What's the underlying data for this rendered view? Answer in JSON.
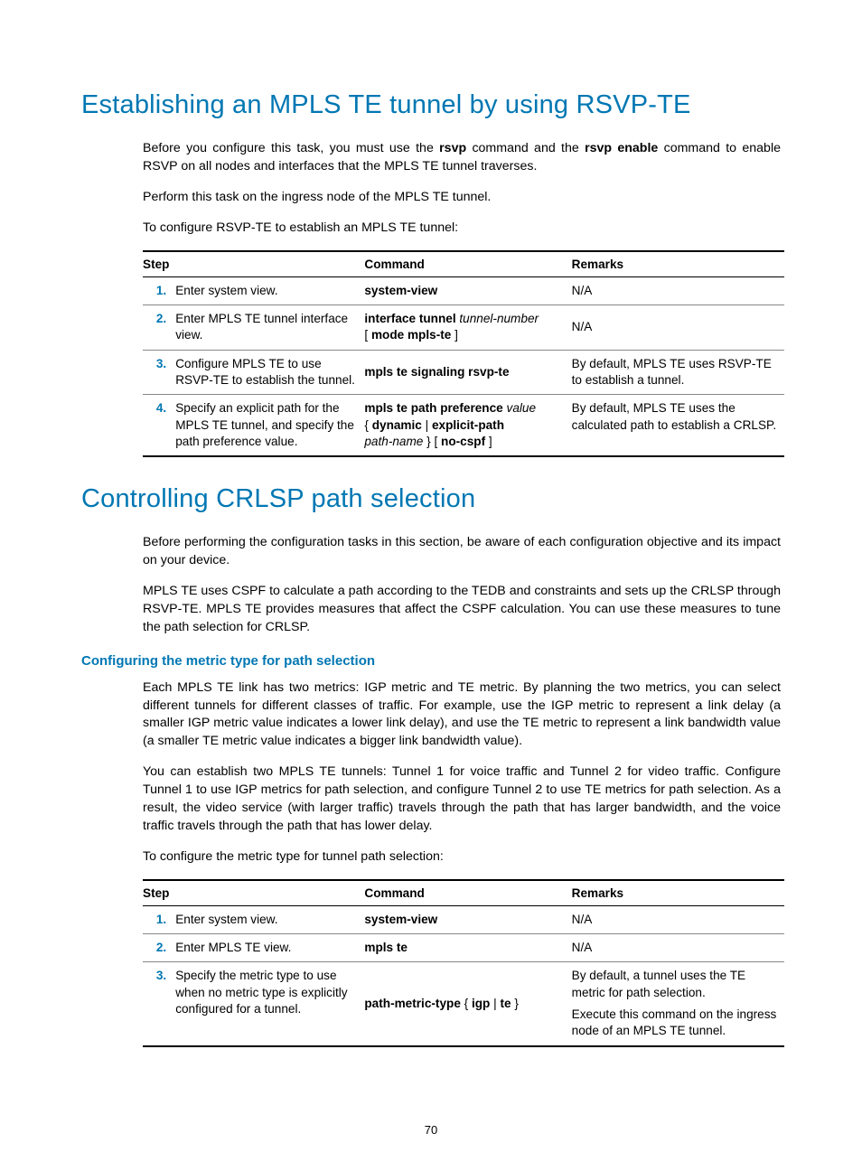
{
  "page_number": "70",
  "section1": {
    "title": "Establishing an MPLS TE tunnel by using RSVP-TE",
    "para1_a": "Before you configure this task, you must use the ",
    "para1_b": "rsvp",
    "para1_c": " command and the ",
    "para1_d": "rsvp enable",
    "para1_e": " command to enable RSVP on all nodes and interfaces that the MPLS TE tunnel traverses.",
    "para2": "Perform this task on the ingress node of the MPLS TE tunnel.",
    "para3": "To configure RSVP-TE to establish an MPLS TE tunnel:"
  },
  "table1": {
    "h1": "Step",
    "h2": "Command",
    "h3": "Remarks",
    "r1": {
      "n": "1.",
      "step": "Enter system view.",
      "cmd": "system-view",
      "rem": "N/A"
    },
    "r2": {
      "n": "2.",
      "step": "Enter MPLS TE tunnel interface view.",
      "cmd_a": "interface tunnel ",
      "cmd_b": "tunnel-number",
      "cmd_c": "[ ",
      "cmd_d": "mode mpls-te",
      "cmd_e": " ]",
      "rem": "N/A"
    },
    "r3": {
      "n": "3.",
      "step": "Configure MPLS TE to use RSVP-TE to establish the tunnel.",
      "cmd": "mpls te signaling rsvp-te",
      "rem": "By default, MPLS TE uses RSVP-TE to establish a tunnel."
    },
    "r4": {
      "n": "4.",
      "step": "Specify an explicit path for the MPLS TE tunnel, and specify the path preference value.",
      "cmd_a": "mpls te path preference ",
      "cmd_b": "value",
      "cmd_c": "{ ",
      "cmd_d": "dynamic",
      "cmd_e": " | ",
      "cmd_f": "explicit-path",
      "cmd_g": "path-name",
      "cmd_h": " } [ ",
      "cmd_i": "no-cspf",
      "cmd_j": " ]",
      "rem": "By default, MPLS TE uses the calculated path to establish a CRLSP."
    }
  },
  "section2": {
    "title": "Controlling CRLSP path selection",
    "para1": "Before performing the configuration tasks in this section, be aware of each configuration objective and its impact on your device.",
    "para2": "MPLS TE uses CSPF to calculate a path according to the TEDB and constraints and sets up the CRLSP through RSVP-TE. MPLS TE provides measures that affect the CSPF calculation. You can use these measures to tune the path selection for CRLSP.",
    "sub1": "Configuring the metric type for path selection",
    "para3": "Each MPLS TE link has two metrics: IGP metric and TE metric. By planning the two metrics, you can select different tunnels for different classes of traffic. For example, use the IGP metric to represent a link delay (a smaller IGP metric value indicates a lower link delay), and use the TE metric to represent a link bandwidth value (a smaller TE metric value indicates a bigger link bandwidth value).",
    "para4": "You can establish two MPLS TE tunnels: Tunnel 1 for voice traffic and Tunnel 2 for video traffic. Configure Tunnel 1 to use IGP metrics for path selection, and configure Tunnel 2 to use TE metrics for path selection. As a result, the video service (with larger traffic) travels through the path that has larger bandwidth, and the voice traffic travels through the path that has lower delay.",
    "para5": "To configure the metric type for tunnel path selection:"
  },
  "table2": {
    "h1": "Step",
    "h2": "Command",
    "h3": "Remarks",
    "r1": {
      "n": "1.",
      "step": "Enter system view.",
      "cmd": "system-view",
      "rem": "N/A"
    },
    "r2": {
      "n": "2.",
      "step": "Enter MPLS TE view.",
      "cmd": "mpls te",
      "rem": "N/A"
    },
    "r3": {
      "n": "3.",
      "step": "Specify the metric type to use when no metric type is explicitly configured for a tunnel.",
      "cmd_a": "path-metric-type",
      "cmd_b": " { ",
      "cmd_c": "igp",
      "cmd_d": " | ",
      "cmd_e": "te",
      "cmd_f": " }",
      "rem1": "By default, a tunnel uses the TE metric for path selection.",
      "rem2": "Execute this command on the ingress node of an MPLS TE tunnel."
    }
  }
}
